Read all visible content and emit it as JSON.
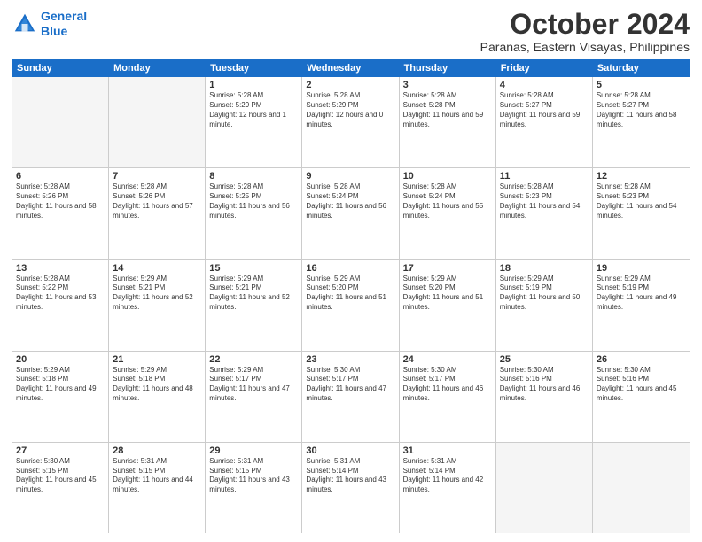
{
  "header": {
    "logo_line1": "General",
    "logo_line2": "Blue",
    "month_title": "October 2024",
    "subtitle": "Paranas, Eastern Visayas, Philippines"
  },
  "days_of_week": [
    "Sunday",
    "Monday",
    "Tuesday",
    "Wednesday",
    "Thursday",
    "Friday",
    "Saturday"
  ],
  "weeks": [
    [
      {
        "day": "",
        "info": ""
      },
      {
        "day": "",
        "info": ""
      },
      {
        "day": "1",
        "info": "Sunrise: 5:28 AM\nSunset: 5:29 PM\nDaylight: 12 hours and 1 minute."
      },
      {
        "day": "2",
        "info": "Sunrise: 5:28 AM\nSunset: 5:29 PM\nDaylight: 12 hours and 0 minutes."
      },
      {
        "day": "3",
        "info": "Sunrise: 5:28 AM\nSunset: 5:28 PM\nDaylight: 11 hours and 59 minutes."
      },
      {
        "day": "4",
        "info": "Sunrise: 5:28 AM\nSunset: 5:27 PM\nDaylight: 11 hours and 59 minutes."
      },
      {
        "day": "5",
        "info": "Sunrise: 5:28 AM\nSunset: 5:27 PM\nDaylight: 11 hours and 58 minutes."
      }
    ],
    [
      {
        "day": "6",
        "info": "Sunrise: 5:28 AM\nSunset: 5:26 PM\nDaylight: 11 hours and 58 minutes."
      },
      {
        "day": "7",
        "info": "Sunrise: 5:28 AM\nSunset: 5:26 PM\nDaylight: 11 hours and 57 minutes."
      },
      {
        "day": "8",
        "info": "Sunrise: 5:28 AM\nSunset: 5:25 PM\nDaylight: 11 hours and 56 minutes."
      },
      {
        "day": "9",
        "info": "Sunrise: 5:28 AM\nSunset: 5:24 PM\nDaylight: 11 hours and 56 minutes."
      },
      {
        "day": "10",
        "info": "Sunrise: 5:28 AM\nSunset: 5:24 PM\nDaylight: 11 hours and 55 minutes."
      },
      {
        "day": "11",
        "info": "Sunrise: 5:28 AM\nSunset: 5:23 PM\nDaylight: 11 hours and 54 minutes."
      },
      {
        "day": "12",
        "info": "Sunrise: 5:28 AM\nSunset: 5:23 PM\nDaylight: 11 hours and 54 minutes."
      }
    ],
    [
      {
        "day": "13",
        "info": "Sunrise: 5:28 AM\nSunset: 5:22 PM\nDaylight: 11 hours and 53 minutes."
      },
      {
        "day": "14",
        "info": "Sunrise: 5:29 AM\nSunset: 5:21 PM\nDaylight: 11 hours and 52 minutes."
      },
      {
        "day": "15",
        "info": "Sunrise: 5:29 AM\nSunset: 5:21 PM\nDaylight: 11 hours and 52 minutes."
      },
      {
        "day": "16",
        "info": "Sunrise: 5:29 AM\nSunset: 5:20 PM\nDaylight: 11 hours and 51 minutes."
      },
      {
        "day": "17",
        "info": "Sunrise: 5:29 AM\nSunset: 5:20 PM\nDaylight: 11 hours and 51 minutes."
      },
      {
        "day": "18",
        "info": "Sunrise: 5:29 AM\nSunset: 5:19 PM\nDaylight: 11 hours and 50 minutes."
      },
      {
        "day": "19",
        "info": "Sunrise: 5:29 AM\nSunset: 5:19 PM\nDaylight: 11 hours and 49 minutes."
      }
    ],
    [
      {
        "day": "20",
        "info": "Sunrise: 5:29 AM\nSunset: 5:18 PM\nDaylight: 11 hours and 49 minutes."
      },
      {
        "day": "21",
        "info": "Sunrise: 5:29 AM\nSunset: 5:18 PM\nDaylight: 11 hours and 48 minutes."
      },
      {
        "day": "22",
        "info": "Sunrise: 5:29 AM\nSunset: 5:17 PM\nDaylight: 11 hours and 47 minutes."
      },
      {
        "day": "23",
        "info": "Sunrise: 5:30 AM\nSunset: 5:17 PM\nDaylight: 11 hours and 47 minutes."
      },
      {
        "day": "24",
        "info": "Sunrise: 5:30 AM\nSunset: 5:17 PM\nDaylight: 11 hours and 46 minutes."
      },
      {
        "day": "25",
        "info": "Sunrise: 5:30 AM\nSunset: 5:16 PM\nDaylight: 11 hours and 46 minutes."
      },
      {
        "day": "26",
        "info": "Sunrise: 5:30 AM\nSunset: 5:16 PM\nDaylight: 11 hours and 45 minutes."
      }
    ],
    [
      {
        "day": "27",
        "info": "Sunrise: 5:30 AM\nSunset: 5:15 PM\nDaylight: 11 hours and 45 minutes."
      },
      {
        "day": "28",
        "info": "Sunrise: 5:31 AM\nSunset: 5:15 PM\nDaylight: 11 hours and 44 minutes."
      },
      {
        "day": "29",
        "info": "Sunrise: 5:31 AM\nSunset: 5:15 PM\nDaylight: 11 hours and 43 minutes."
      },
      {
        "day": "30",
        "info": "Sunrise: 5:31 AM\nSunset: 5:14 PM\nDaylight: 11 hours and 43 minutes."
      },
      {
        "day": "31",
        "info": "Sunrise: 5:31 AM\nSunset: 5:14 PM\nDaylight: 11 hours and 42 minutes."
      },
      {
        "day": "",
        "info": ""
      },
      {
        "day": "",
        "info": ""
      }
    ]
  ]
}
